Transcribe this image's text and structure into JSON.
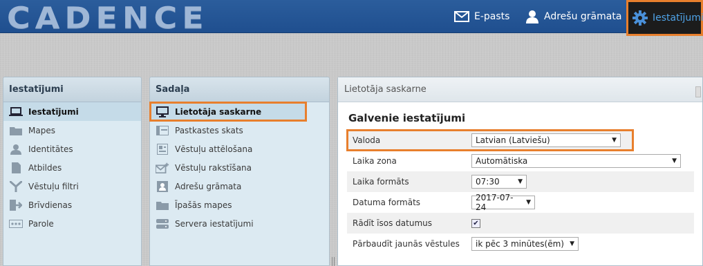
{
  "header": {
    "logo_text": "CADENCE",
    "nav": [
      {
        "label": "E-pasts",
        "icon": "envelope-icon"
      },
      {
        "label": "Adrešu grāmata",
        "icon": "person-icon"
      },
      {
        "label": "Iestatījumi",
        "icon": "gear-icon"
      }
    ]
  },
  "settings_panel": {
    "title": "Iestatījumi",
    "items": [
      {
        "label": "Iestatījumi",
        "icon": "laptop-icon",
        "active": true
      },
      {
        "label": "Mapes",
        "icon": "folder-icon"
      },
      {
        "label": "Identitātes",
        "icon": "user-icon"
      },
      {
        "label": "Atbildes",
        "icon": "document-icon"
      },
      {
        "label": "Vēstuļu filtri",
        "icon": "filter-icon"
      },
      {
        "label": "Brīvdienas",
        "icon": "exit-icon"
      },
      {
        "label": "Parole",
        "icon": "password-icon"
      }
    ]
  },
  "section_panel": {
    "title": "Sadaļa",
    "items": [
      {
        "label": "Lietotāja saskarne",
        "icon": "monitor-icon",
        "active": true
      },
      {
        "label": "Pastkastes skats",
        "icon": "mailbox-view-icon"
      },
      {
        "label": "Vēstuļu attēlošana",
        "icon": "message-display-icon"
      },
      {
        "label": "Vēstuļu rakstīšana",
        "icon": "compose-icon"
      },
      {
        "label": "Adrešu grāmata",
        "icon": "addressbook-icon"
      },
      {
        "label": "Īpašās mapes",
        "icon": "special-folder-icon"
      },
      {
        "label": "Servera iestatījumi",
        "icon": "server-icon"
      }
    ]
  },
  "main": {
    "header": "Lietotāja saskarne",
    "section_title": "Galvenie iestatījumi",
    "rows": [
      {
        "label": "Valoda",
        "value": "Latvian (Latviešu)"
      },
      {
        "label": "Laika zona",
        "value": "Automātiska"
      },
      {
        "label": "Laika formāts",
        "value": "07:30"
      },
      {
        "label": "Datuma formāts",
        "value": "2017-07-24"
      },
      {
        "label": "Rādīt īsos datumus",
        "checked": true
      },
      {
        "label": "Pārbaudīt jaunās vēstules",
        "value": "ik pēc 3 minūtes(ēm)"
      }
    ]
  },
  "colors": {
    "header_bg": "#2b5d9c",
    "highlight": "#e87f2d",
    "panel_bg": "#dceaf2"
  }
}
